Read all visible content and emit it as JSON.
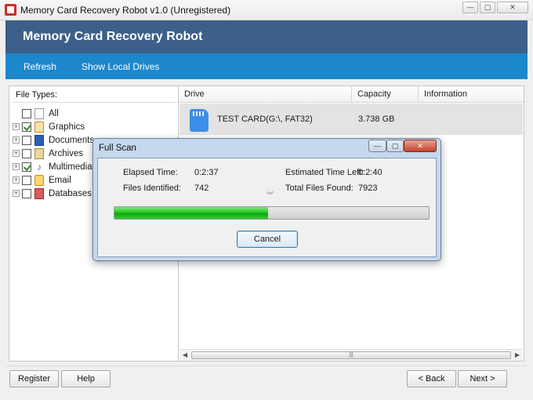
{
  "window": {
    "title": "Memory Card Recovery Robot v1.0 (Unregistered)",
    "buttons": {
      "minimize": "—",
      "maximize": "▢",
      "close": "✕"
    }
  },
  "header": {
    "title": "Memory Card Recovery Robot"
  },
  "nav": {
    "refresh": "Refresh",
    "show_local_drives": "Show Local Drives"
  },
  "file_types": {
    "label": "File Types:",
    "items": [
      {
        "label": "All",
        "checked": false,
        "icon": "blank-file-icon"
      },
      {
        "label": "Graphics",
        "checked": true,
        "icon": "graphics-icon"
      },
      {
        "label": "Documents",
        "checked": false,
        "icon": "word-doc-icon"
      },
      {
        "label": "Archives",
        "checked": false,
        "icon": "archive-icon"
      },
      {
        "label": "Multimedia",
        "checked": true,
        "icon": "music-note-icon"
      },
      {
        "label": "Email",
        "checked": false,
        "icon": "email-icon"
      },
      {
        "label": "Databases",
        "checked": false,
        "icon": "database-icon"
      }
    ]
  },
  "drives_table": {
    "columns": [
      "Drive",
      "Capacity",
      "Information"
    ],
    "rows": [
      {
        "drive": "TEST CARD(G:\\, FAT32)",
        "capacity": "3.738 GB",
        "information": ""
      }
    ],
    "scrollbar_grip": "|||"
  },
  "dialog": {
    "title": "Full Scan",
    "elapsed_label": "Elapsed Time:",
    "elapsed_value": "0:2:37",
    "remaining_label": "Estimated Time Left:",
    "remaining_value": "0:2:40",
    "identified_label": "Files Identified:",
    "identified_value": "742",
    "total_label": "Total Files Found:",
    "total_value": "7923",
    "progress_fraction": 0.49,
    "cancel": "Cancel",
    "chevron": "︾"
  },
  "footer": {
    "register": "Register",
    "help": "Help",
    "back": "< Back",
    "next": "Next >"
  },
  "colors": {
    "header_bg": "#3d5f8a",
    "nav_bg": "#1d87cc",
    "progress_green": "#25c425",
    "sd_card_blue": "#3a8fe6"
  }
}
